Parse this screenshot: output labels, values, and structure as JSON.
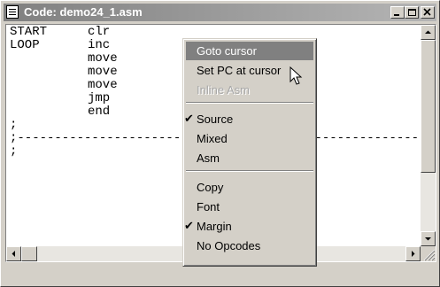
{
  "window": {
    "title": "Code: demo24_1.asm",
    "controls": {
      "minimize": "minimize-icon",
      "maximize": "maximize-icon",
      "close": "close-icon"
    }
  },
  "code": {
    "lines": [
      {
        "label": "START",
        "op": "clr",
        "operand": ""
      },
      {
        "label": "LOOP",
        "op": "inc",
        "operand": ""
      },
      {
        "label": "",
        "op": "move",
        "operand": ""
      },
      {
        "label": "",
        "op": "move",
        "operand": ""
      },
      {
        "label": "",
        "op": "move",
        "operand": ""
      },
      {
        "label": "",
        "op": "jmp",
        "operand": ""
      },
      {
        "label": "",
        "op": "end",
        "operand": ""
      },
      {
        "label": ";",
        "op": "",
        "operand": ""
      },
      {
        "label": ";---------------------------------------------------------",
        "op": "",
        "operand": ""
      },
      {
        "label": ";",
        "op": "",
        "operand": ""
      }
    ]
  },
  "context_menu": {
    "items": [
      {
        "label": "Goto cursor",
        "highlighted": true,
        "disabled": false,
        "checked": false
      },
      {
        "label": "Set PC at cursor",
        "highlighted": false,
        "disabled": false,
        "checked": false
      },
      {
        "label": "Inline Asm",
        "highlighted": false,
        "disabled": true,
        "checked": false
      },
      {
        "label": "Source",
        "highlighted": false,
        "disabled": false,
        "checked": true
      },
      {
        "label": "Mixed",
        "highlighted": false,
        "disabled": false,
        "checked": false
      },
      {
        "label": "Asm",
        "highlighted": false,
        "disabled": false,
        "checked": false
      },
      {
        "label": "Copy",
        "highlighted": false,
        "disabled": false,
        "checked": false
      },
      {
        "label": "Font",
        "highlighted": false,
        "disabled": false,
        "checked": false
      },
      {
        "label": "Margin",
        "highlighted": false,
        "disabled": false,
        "checked": true
      },
      {
        "label": "No Opcodes",
        "highlighted": false,
        "disabled": false,
        "checked": false
      }
    ],
    "check_glyph": "✔"
  },
  "colors": {
    "titlebar_inactive": "#808080",
    "menu_highlight": "#808080",
    "face": "#d4d0c8"
  }
}
